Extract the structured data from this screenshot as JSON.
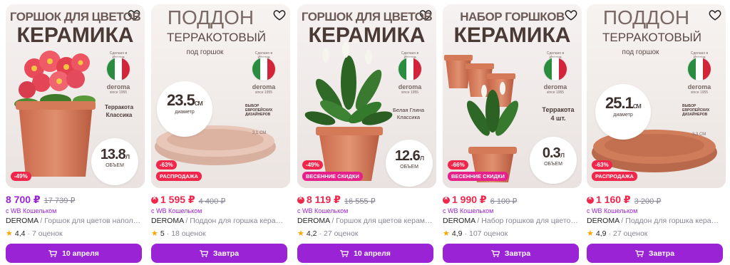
{
  "colors": {
    "accent": "#9b23d6",
    "discount": "#f0264a",
    "spring": "#e6228a"
  },
  "cards": [
    {
      "headline": "ГОРШОК ДЛЯ ЦВЕТОВ",
      "subhead": "КЕРАМИКА",
      "made": "Сделано в Италии",
      "brand": "deroma",
      "since": "since 1955",
      "note": "Терракота\nКлассика",
      "bubble_num": "13.8",
      "bubble_unit": "л",
      "bubble_cap": "ОБЪЕМ",
      "discount": "-49%",
      "tag": "",
      "price": "8 700 ₽",
      "old_price": "17 739 ₽",
      "wallet": "с WB Кошельком",
      "brand_name": "DEROMA",
      "product": " / Горшок для цветов напольный",
      "rating": "4,4",
      "reviews": "7 оценок",
      "delivery": "10 апреля"
    },
    {
      "headline": "ПОДДОН",
      "subhead": "ТЕРРАКОТОВЫЙ",
      "sub2": "под горшок",
      "made": "Сделано в Италии",
      "brand": "deroma",
      "since": "since 1955",
      "note": "ВЫБОР\nЕВРОПЕЙСКИХ\nДИЗАЙНЕРОВ",
      "bubble_num": "23.5",
      "bubble_unit": "см",
      "bubble_cap": "диаметр",
      "dim_label": "3,1 СМ",
      "discount": "-63%",
      "tag": "РАСПРОДАЖА",
      "price": "1 595 ₽",
      "old_price": "4 400 ₽",
      "wallet": "с WB Кошельком",
      "brand_name": "DEROMA",
      "product": " / Поддон для горшка керамический",
      "rating": "5",
      "reviews": "18 оценок",
      "delivery": "Завтра"
    },
    {
      "headline": "ГОРШОК ДЛЯ ЦВЕТОВ",
      "subhead": "КЕРАМИКА",
      "made": "Сделано в Италии",
      "brand": "deroma",
      "since": "since 1955",
      "note": "Белая Глина\nКлассика",
      "bubble_num": "12.6",
      "bubble_unit": "л",
      "bubble_cap": "ОБЪЕМ",
      "discount": "-49%",
      "tag": "ВЕСЕННИЕ СКИДКИ",
      "price": "8 119 ₽",
      "old_price": "16 555 ₽",
      "wallet": "с WB Кошельком",
      "brand_name": "DEROMA",
      "product": " / Горшок для цветов керамический",
      "rating": "4,2",
      "reviews": "27 оценок",
      "delivery": "10 апреля"
    },
    {
      "headline": "НАБОР ГОРШКОВ",
      "subhead": "КЕРАМИКА",
      "made": "Сделано в Италии",
      "brand": "deroma",
      "since": "since 1955",
      "note": "Терракота\n4 шт.",
      "bubble_num": "0.3",
      "bubble_unit": "л",
      "bubble_cap": "ОБЪЕМ",
      "discount": "-66%",
      "tag": "ВЕСЕННИЕ СКИДКИ",
      "price": "1 990 ₽",
      "old_price": "6 100 ₽",
      "wallet": "с WB Кошельком",
      "brand_name": "DEROMA",
      "product": " / Набор горшков для цветов керамический",
      "rating": "4,9",
      "reviews": "107 оценок",
      "delivery": "Завтра"
    },
    {
      "headline": "ПОДДОН",
      "subhead": "ТЕРРАКОТОВЫЙ",
      "sub2": "под горшок",
      "made": "Сделано в Италии",
      "brand": "deroma",
      "since": "since 1955",
      "note": "ВЫБОР\nЕВРОПЕЙСКИХ\nДИЗАЙНЕРОВ",
      "bubble_num": "25.1",
      "bubble_unit": "см",
      "bubble_cap": "диаметр",
      "dim_label": "3,3 СМ",
      "discount": "-63%",
      "tag": "РАСПРОДАЖА",
      "price": "1 160 ₽",
      "old_price": "3 200 ₽",
      "wallet": "с WB Кошельком",
      "brand_name": "DEROMA",
      "product": " / Поддон для горшка керамический",
      "rating": "4,9",
      "reviews": "27 оценок",
      "delivery": "Завтра"
    }
  ]
}
